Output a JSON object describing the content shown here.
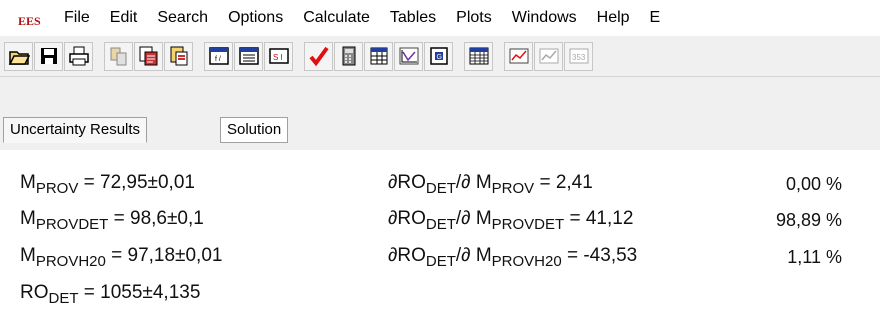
{
  "app": {
    "logo_text": "EES"
  },
  "menu": {
    "items": [
      "File",
      "Edit",
      "Search",
      "Options",
      "Calculate",
      "Tables",
      "Plots",
      "Windows",
      "Help",
      "E"
    ]
  },
  "toolbar": {
    "icons": [
      "open-folder-icon",
      "save-icon",
      "print-icon",
      "equations-icon",
      "copy-format-icon",
      "paste-format-icon",
      "solution-window-icon",
      "formatted-equations-icon",
      "si-units-icon",
      "check-units-icon",
      "calculator-icon",
      "lookup-table-icon",
      "plot-icon",
      "diagram-icon",
      "parametric-table-icon",
      "plot-window-icon",
      "plot-window-2-icon",
      "integral-table-icon"
    ]
  },
  "tabs": [
    {
      "label": "Uncertainty Results",
      "active": true
    },
    {
      "label": "Solution",
      "active": false
    }
  ],
  "results": {
    "rows": [
      {
        "var": "M",
        "sub": "PROV",
        "value": " = 72,95±0,01",
        "partial": {
          "prefix": "∂RO",
          "sub1": "DET",
          "mid": "/∂ M",
          "sub2": "PROV",
          "value": " = 2,41"
        },
        "percent": "0,00 %"
      },
      {
        "var": "M",
        "sub": "PROVDET",
        "value": " = 98,6±0,1",
        "partial": {
          "prefix": "∂RO",
          "sub1": "DET",
          "mid": "/∂ M",
          "sub2": "PROVDET",
          "value": " = 41,12"
        },
        "percent": "98,89 %"
      },
      {
        "var": "M",
        "sub": "PROVH20",
        "value": " = 97,18±0,01",
        "partial": {
          "prefix": "∂RO",
          "sub1": "DET",
          "mid": "/∂ M",
          "sub2": "PROVH20",
          "value": " = -43,53"
        },
        "percent": "1,11 %"
      },
      {
        "var": "RO",
        "sub": "DET",
        "value": " = 1055±4,135"
      }
    ]
  },
  "colors": {
    "logo_red": "#b01414",
    "check_red": "#e01010",
    "toolbar_bg": "#f0f0f0"
  }
}
